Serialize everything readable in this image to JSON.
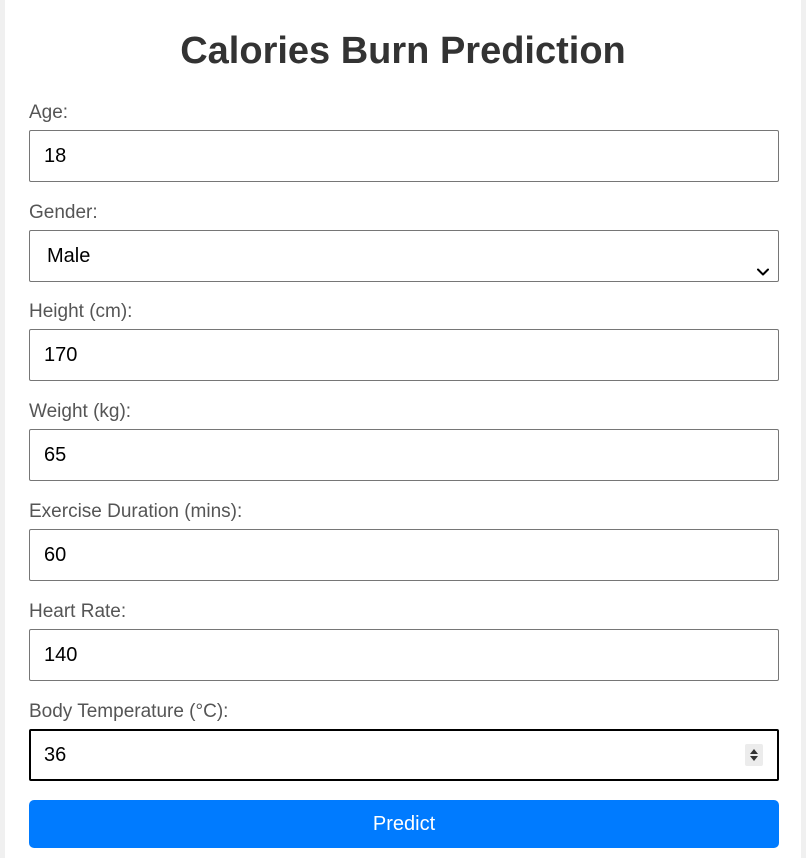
{
  "form": {
    "title": "Calories Burn Prediction",
    "age": {
      "label": "Age:",
      "value": "18"
    },
    "gender": {
      "label": "Gender:",
      "value": "Male"
    },
    "height": {
      "label": "Height (cm):",
      "value": "170"
    },
    "weight": {
      "label": "Weight (kg):",
      "value": "65"
    },
    "duration": {
      "label": "Exercise Duration (mins):",
      "value": "60"
    },
    "heart_rate": {
      "label": "Heart Rate:",
      "value": "140"
    },
    "body_temp": {
      "label": "Body Temperature (°C):",
      "value": "36"
    },
    "predict_label": "Predict"
  },
  "colors": {
    "button": "#007bff",
    "title": "#333333",
    "label": "#555555",
    "focus_border": "#000000"
  },
  "icons": {
    "select": "chevron-down-icon",
    "number": "spinner-arrows-icon"
  }
}
